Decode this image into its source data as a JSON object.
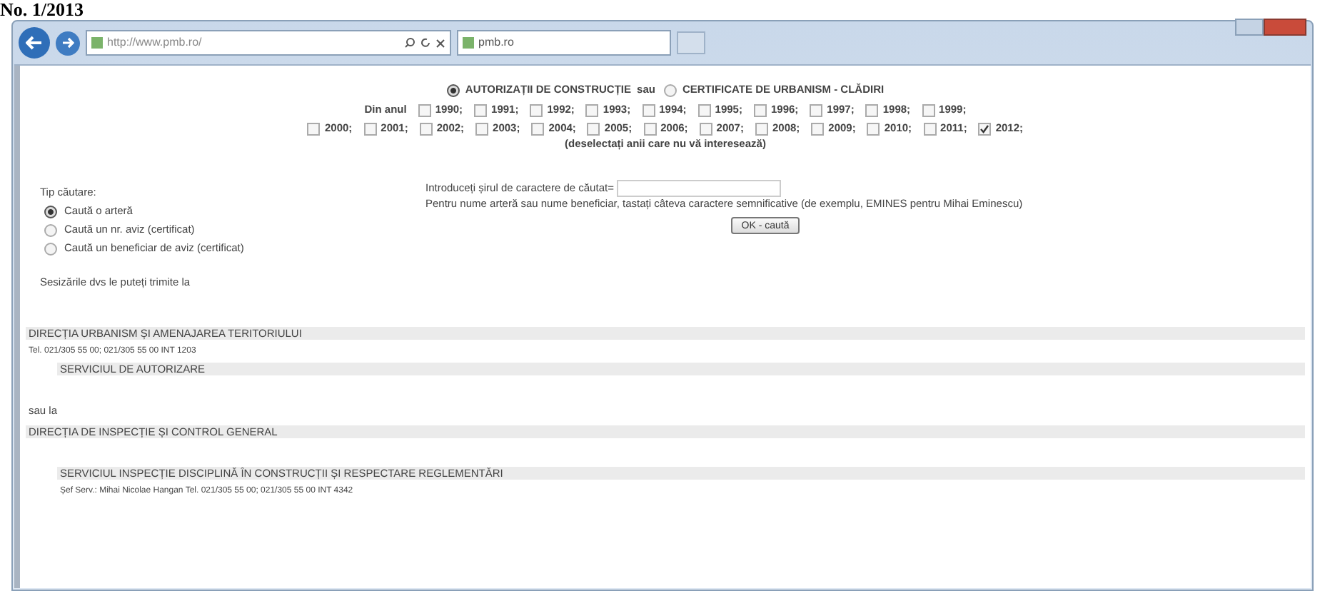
{
  "caption": "No. 1/2013",
  "browser": {
    "address": "http://www.pmb.ro/",
    "tab": "pmb.ro"
  },
  "permit_types": [
    {
      "label": "AUTORIZAȚII DE CONSTRUCȚIE",
      "selected": true
    },
    {
      "label": "CERTIFICATE DE URBANISM - CLĂDIRI",
      "selected": false
    }
  ],
  "permit_joiner": "sau",
  "year_prefix": "Din anul",
  "years": [
    {
      "label": "1990;",
      "checked": false
    },
    {
      "label": "1991;",
      "checked": false
    },
    {
      "label": "1992;",
      "checked": false
    },
    {
      "label": "1993;",
      "checked": false
    },
    {
      "label": "1994;",
      "checked": false
    },
    {
      "label": "1995;",
      "checked": false
    },
    {
      "label": "1996;",
      "checked": false
    },
    {
      "label": "1997;",
      "checked": false
    },
    {
      "label": "1998;",
      "checked": false
    },
    {
      "label": "1999;",
      "checked": false
    },
    {
      "label": "2000;",
      "checked": false
    },
    {
      "label": "2001;",
      "checked": false
    },
    {
      "label": "2002;",
      "checked": false
    },
    {
      "label": "2003;",
      "checked": false
    },
    {
      "label": "2004;",
      "checked": false
    },
    {
      "label": "2005;",
      "checked": false
    },
    {
      "label": "2006;",
      "checked": false
    },
    {
      "label": "2007;",
      "checked": false
    },
    {
      "label": "2008;",
      "checked": false
    },
    {
      "label": "2009;",
      "checked": false
    },
    {
      "label": "2010;",
      "checked": false
    },
    {
      "label": "2011;",
      "checked": false
    },
    {
      "label": "2012;",
      "checked": true
    }
  ],
  "years_hint": "(deselectați anii care nu vă interesează)",
  "search_type": {
    "label": "Tip căutare:",
    "options": [
      {
        "label": "Caută o arteră",
        "selected": true
      },
      {
        "label": "Caută un nr. aviz (certificat)",
        "selected": false
      },
      {
        "label": "Caută un beneficiar de aviz (certificat)",
        "selected": false
      }
    ]
  },
  "query": {
    "label": "Introduceți șirul de caractere de căutat=",
    "hint": "Pentru nume arteră sau nume beneficiar, tastați câteva caractere semnificative (de exemplu, EMINES pentru Mihai Eminescu)",
    "button": "OK - caută"
  },
  "contact_intro": "Sesizările dvs le puteți trimite la",
  "contacts": [
    {
      "kind": "heading",
      "text": "DIRECȚIA URBANISM ȘI AMENAJAREA TERITORIULUI"
    },
    {
      "kind": "note",
      "text": "Tel. 021/305 55 00; 021/305 55 00 INT 1203"
    },
    {
      "kind": "subheading",
      "text": "SERVICIUL DE AUTORIZARE"
    },
    {
      "kind": "gap"
    },
    {
      "kind": "plain",
      "text": "sau la"
    },
    {
      "kind": "heading",
      "text": "DIRECȚIA DE INSPECȚIE ȘI CONTROL GENERAL"
    },
    {
      "kind": "gap"
    },
    {
      "kind": "subheading",
      "text": "SERVICIUL INSPECȚIE DISCIPLINĂ ÎN CONSTRUCȚII ȘI RESPECTARE REGLEMENTĂRI"
    },
    {
      "kind": "subnote",
      "text": "Șef Serv.: Mihai Nicolae Hangan Tel. 021/305 55 00; 021/305 55 00 INT 4342"
    }
  ]
}
